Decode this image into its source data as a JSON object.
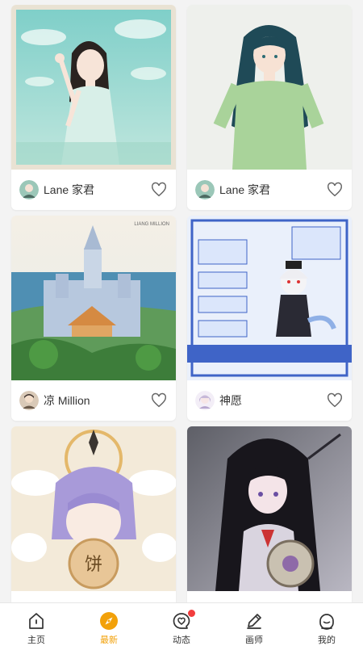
{
  "feed": {
    "items": [
      {
        "author": "Lane 家君",
        "avatar": "avatar-lane",
        "liked": false,
        "art": "girl-on-sky-balcony"
      },
      {
        "author": "Lane 家君",
        "avatar": "avatar-lane",
        "liked": false,
        "art": "girl-green-shirt"
      },
      {
        "author": "凉 Million",
        "avatar": "avatar-million",
        "liked": false,
        "art": "cathedral-landscape",
        "art_caption": "LIANG MILLION"
      },
      {
        "author": "神愿",
        "avatar": "avatar-shenyuan",
        "liked": false,
        "art": "character-setting-sheet"
      },
      {
        "author": "",
        "avatar": "",
        "liked": false,
        "art": "girl-with-mooncake",
        "art_caption": "饼"
      },
      {
        "author": "",
        "avatar": "",
        "liked": false,
        "art": "dark-hair-girl-shield"
      }
    ]
  },
  "tabbar": {
    "tabs": [
      {
        "label": "主页",
        "icon": "home-icon",
        "active": false
      },
      {
        "label": "最新",
        "icon": "compass-icon",
        "active": true
      },
      {
        "label": "动态",
        "icon": "heart-message-icon",
        "active": false,
        "badge": true
      },
      {
        "label": "画师",
        "icon": "pen-icon",
        "active": false
      },
      {
        "label": "我的",
        "icon": "profile-icon",
        "active": false
      }
    ]
  },
  "colors": {
    "accent": "#f2a10a",
    "badge": "#f23d3d",
    "background": "#f3f3f3"
  }
}
